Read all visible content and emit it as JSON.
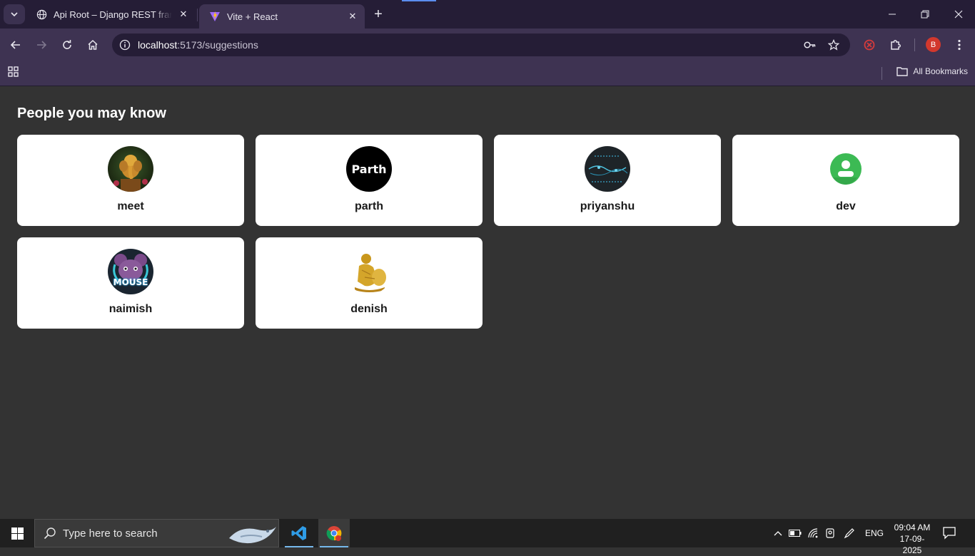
{
  "browser": {
    "tabs": [
      {
        "title": "Api Root – Django REST framework",
        "active": false
      },
      {
        "title": "Vite + React",
        "active": true
      }
    ],
    "url": {
      "host": "localhost",
      "port_path": ":5173/suggestions"
    },
    "profile_initial": "B",
    "bookmarks": {
      "all_label": "All Bookmarks"
    }
  },
  "page": {
    "title": "People you may know",
    "people": [
      {
        "name": "meet",
        "avatar": "ganesha-avatar-icon"
      },
      {
        "name": "parth",
        "avatar": "parth-text-avatar-icon",
        "avatar_text": "Parth"
      },
      {
        "name": "priyanshu",
        "avatar": "priyanshu-dark-avatar-icon"
      },
      {
        "name": "dev",
        "avatar": "default-user-avatar-icon"
      },
      {
        "name": "naimish",
        "avatar": "mouse-mascot-avatar-icon",
        "avatar_text": "MOUSE"
      },
      {
        "name": "denish",
        "avatar": "gold-statue-avatar-icon"
      }
    ]
  },
  "taskbar": {
    "search_placeholder": "Type here to search",
    "language": "ENG",
    "time": "09:04 AM",
    "date": "17-09-2025"
  },
  "colors": {
    "browser_frame": "#251d36",
    "toolbar": "#3e3352",
    "page_bg": "#333333",
    "card_bg": "#ffffff",
    "profile": "#d2382d",
    "default_avatar": "#3cba54"
  }
}
